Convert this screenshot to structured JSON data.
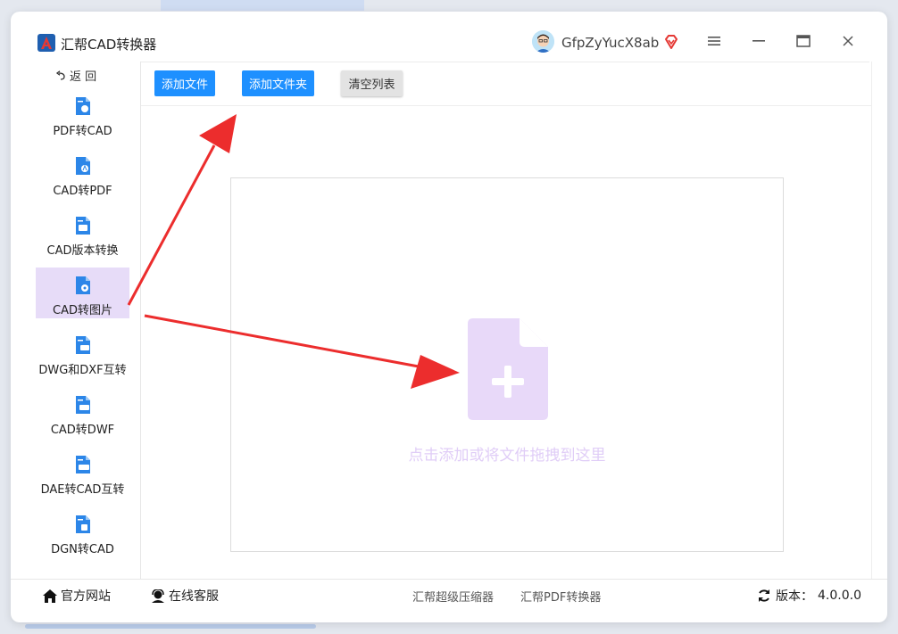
{
  "app": {
    "title": "汇帮CAD转换器",
    "username": "GfpZyYucX8ab",
    "accent_color": "#1e90ff",
    "active_color": "#e7dcf8"
  },
  "sidebar": {
    "back_label": "返 回",
    "items": [
      {
        "label": "PDF转CAD",
        "icon": "pdf-to-cad-icon"
      },
      {
        "label": "CAD转PDF",
        "icon": "cad-to-pdf-icon"
      },
      {
        "label": "CAD版本转换",
        "icon": "cad-version-icon"
      },
      {
        "label": "CAD转图片",
        "icon": "cad-to-image-icon",
        "active": true
      },
      {
        "label": "DWG和DXF互转",
        "icon": "dwg-dxf-icon"
      },
      {
        "label": "CAD转DWF",
        "icon": "cad-to-dwf-icon"
      },
      {
        "label": "DAE转CAD互转",
        "icon": "dae-to-cad-icon"
      },
      {
        "label": "DGN转CAD",
        "icon": "dgn-to-cad-icon"
      }
    ]
  },
  "toolbar": {
    "add_file": "添加文件",
    "add_folder": "添加文件夹",
    "clear_list": "清空列表"
  },
  "dropzone": {
    "hint": "点击添加或将文件拖拽到这里",
    "icon": "add-file-icon"
  },
  "footer": {
    "official_site": "官方网站",
    "online_service": "在线客服",
    "compressor": "汇帮超级压缩器",
    "pdf_converter": "汇帮PDF转换器",
    "version_label": "版本：",
    "version": "4.0.0.0"
  }
}
